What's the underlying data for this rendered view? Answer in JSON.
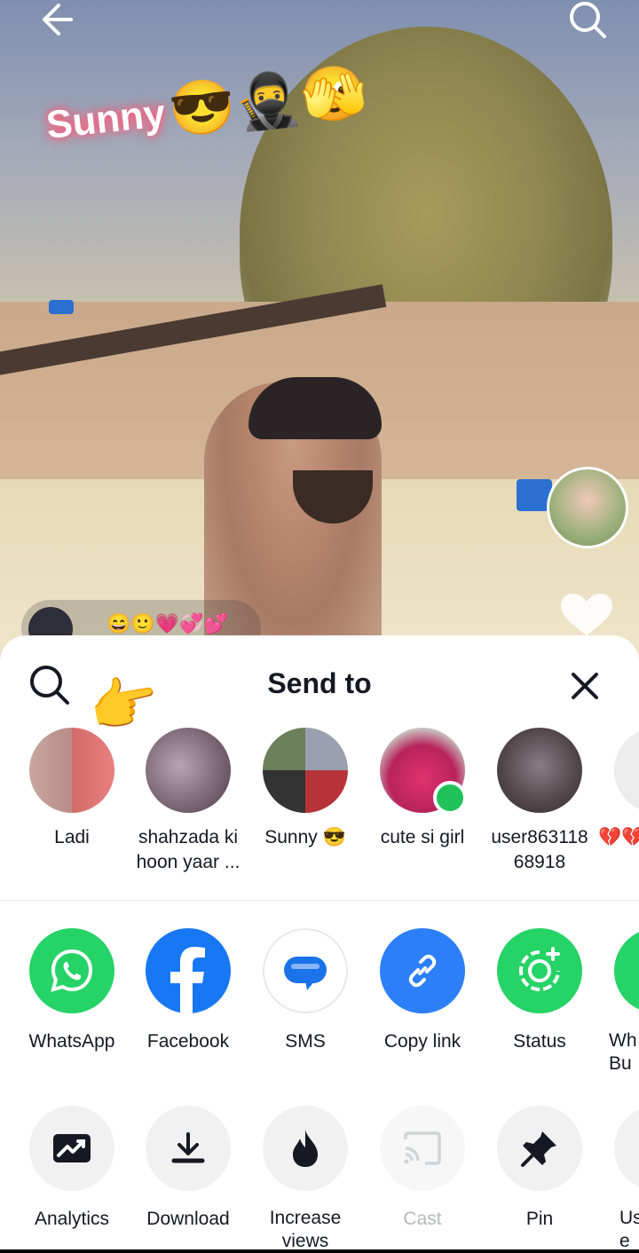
{
  "video": {
    "overlay_text": "Sunny",
    "overlay_emoji": "😎🥷🫣",
    "comment_emoji": "😄🙂💗💞💕"
  },
  "sheet": {
    "title": "Send to",
    "contacts": [
      {
        "name": "Ladi"
      },
      {
        "name": "shahzada ki\nhoon yaar ..."
      },
      {
        "name": "Sunny 😎"
      },
      {
        "name": "cute si girl",
        "online": true
      },
      {
        "name": "user863118\n68918"
      },
      {
        "name": "💔💔"
      }
    ],
    "share_apps": [
      {
        "label": "WhatsApp",
        "icon": "whatsapp-icon",
        "color": "#25D366"
      },
      {
        "label": "Facebook",
        "icon": "facebook-icon",
        "color": "#1877F2"
      },
      {
        "label": "SMS",
        "icon": "sms-icon",
        "color": "#1A73E8"
      },
      {
        "label": "Copy link",
        "icon": "link-icon",
        "color": "#2D7FF9"
      },
      {
        "label": "Status",
        "icon": "status-icon",
        "color": "#25D366"
      },
      {
        "label": "Wh\nBu",
        "icon": "whatsapp-business-icon",
        "color": "#25D366"
      }
    ],
    "actions": [
      {
        "label": "Analytics",
        "icon": "analytics-icon"
      },
      {
        "label": "Download",
        "icon": "download-icon"
      },
      {
        "label": "Increase\nviews",
        "icon": "flame-icon"
      },
      {
        "label": "Cast",
        "icon": "cast-icon",
        "disabled": true
      },
      {
        "label": "Pin",
        "icon": "pin-icon"
      },
      {
        "label": "Us\ne",
        "icon": "more-icon"
      }
    ]
  }
}
